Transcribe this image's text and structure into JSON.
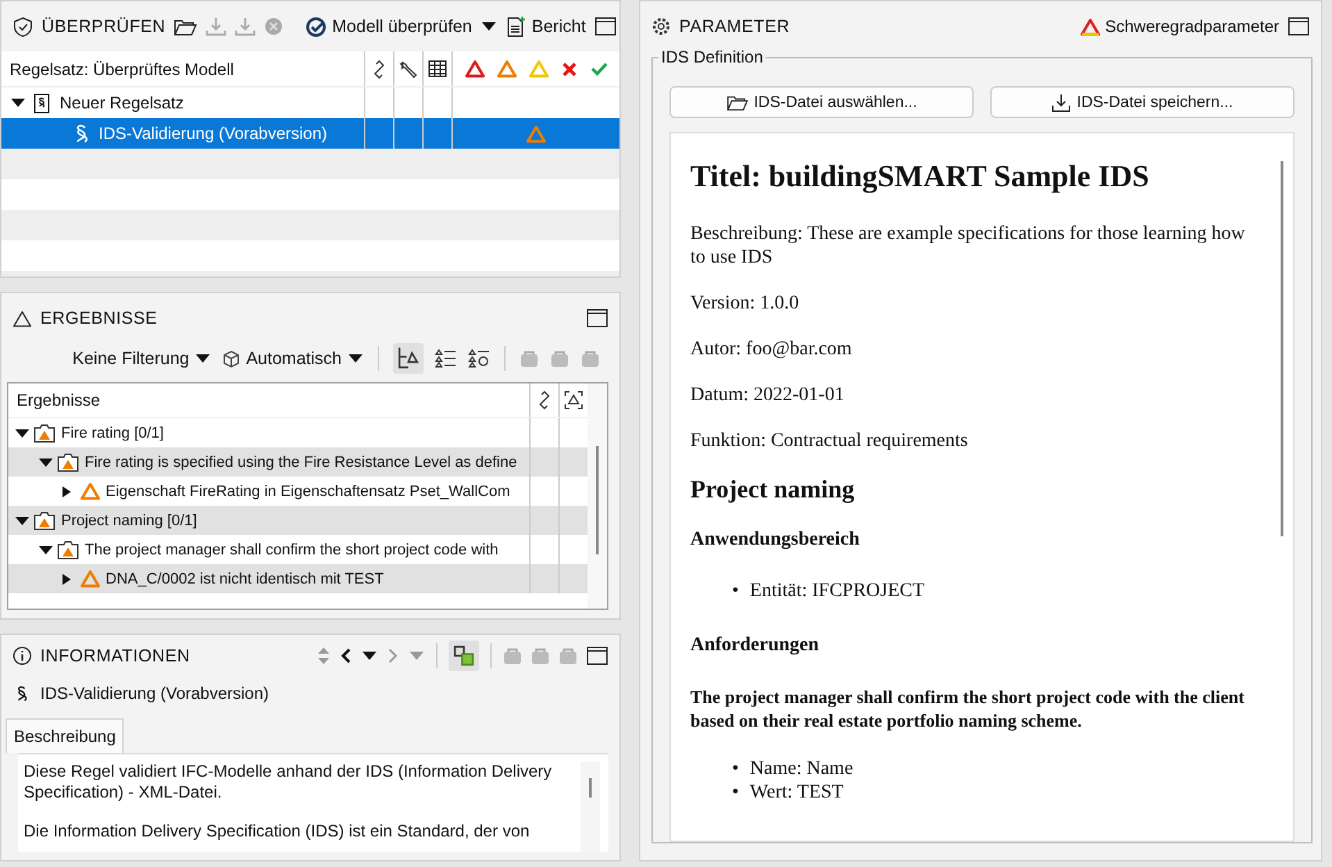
{
  "check_panel": {
    "title": "ÜBERPRÜFEN",
    "run_button": "Modell überprüfen",
    "report_button": "Bericht",
    "column_header": "Regelsatz: Überprüftes Modell",
    "rows": [
      {
        "label": "Neuer Regelsatz",
        "kind": "ruleset",
        "expanded": true,
        "selected": false,
        "children": [
          {
            "label": "IDS-Validierung (Vorabversion)",
            "kind": "rule",
            "selected": true
          }
        ]
      }
    ]
  },
  "results_panel": {
    "title": "ERGEBNISSE",
    "filter": "Keine Filterung",
    "mode": "Automatisch",
    "column_header": "Ergebnisse",
    "rows": [
      {
        "label": "Fire rating [0/1]",
        "kind": "group",
        "expanded": true,
        "children": [
          {
            "label": "Fire rating is specified using the Fire Resistance Level as define",
            "kind": "group",
            "expanded": true,
            "children": [
              {
                "label": "Eigenschaft FireRating in Eigenschaftensatz Pset_WallCom",
                "kind": "issue",
                "expanded": false
              }
            ]
          }
        ]
      },
      {
        "label": "Project naming [0/1]",
        "kind": "group",
        "expanded": true,
        "children": [
          {
            "label": "The project manager shall confirm the short project code with",
            "kind": "group",
            "expanded": true,
            "children": [
              {
                "label": "DNA_C/0002 ist nicht identisch mit TEST",
                "kind": "issue",
                "expanded": false
              }
            ]
          }
        ]
      }
    ]
  },
  "info_panel": {
    "title": "INFORMATIONEN",
    "rule_name": "IDS-Validierung (Vorabversion)",
    "tabs": [
      {
        "label": "Beschreibung",
        "selected": true
      }
    ],
    "description": [
      "Diese Regel validiert IFC-Modelle anhand der IDS (Information Delivery Specification) - XML-Datei.",
      "Die Information Delivery Specification (IDS) ist ein Standard, der von"
    ]
  },
  "parameter_panel": {
    "title": "PARAMETER",
    "severity_link": "Schweregradparameter",
    "group_title": "IDS Definition",
    "buttons": [
      {
        "label": "IDS-Datei auswählen...",
        "kind": "open"
      },
      {
        "label": "IDS-Datei speichern...",
        "kind": "save"
      }
    ],
    "document": [
      {
        "kind": "h1",
        "text": "Titel: buildingSMART Sample IDS"
      },
      {
        "kind": "p",
        "text": "Beschreibung: These are example specifications for those learning how to use IDS"
      },
      {
        "kind": "p",
        "text": "Version: 1.0.0"
      },
      {
        "kind": "p",
        "text": "Autor: foo@bar.com"
      },
      {
        "kind": "p",
        "text": "Datum: 2022-01-01"
      },
      {
        "kind": "p",
        "text": "Funktion: Contractual requirements"
      },
      {
        "kind": "h2",
        "text": "Project naming"
      },
      {
        "kind": "h3",
        "text": "Anwendungsbereich"
      },
      {
        "kind": "li",
        "marker": "•",
        "text": "Entität: IFCPROJECT"
      },
      {
        "kind": "h3",
        "text": "Anforderungen"
      },
      {
        "kind": "strong",
        "text": "The project manager shall confirm the short project code with the client based on their real estate portfolio naming scheme."
      },
      {
        "kind": "li",
        "marker": "•",
        "text": "Name: Name"
      },
      {
        "kind": "li",
        "marker": "•",
        "text": "Wert: TEST"
      }
    ]
  }
}
